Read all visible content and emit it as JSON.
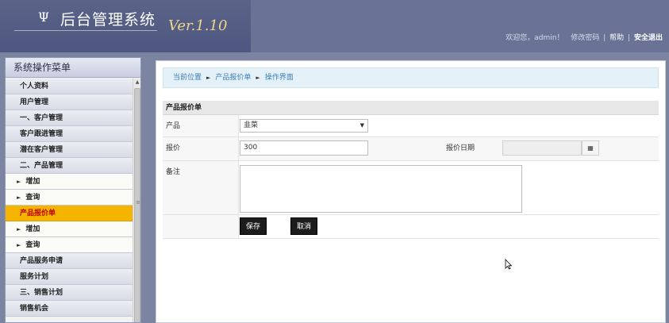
{
  "header": {
    "logo_mark": "Ψ",
    "title": "后台管理系统",
    "version": "Ver.1.10",
    "welcome": "欢迎您，admin！",
    "change_password": "修改密码",
    "help": "帮助",
    "logout": "安全退出",
    "separator": "|"
  },
  "sidebar": {
    "title": "系统操作菜单",
    "items": [
      {
        "label": "个人资料"
      },
      {
        "label": "用户管理"
      },
      {
        "label": "一、客户管理"
      },
      {
        "label": "客户跟进管理"
      },
      {
        "label": "潜在客户管理"
      },
      {
        "label": "二、产品管理"
      },
      {
        "label": "增加"
      },
      {
        "label": "查询"
      },
      {
        "label": "产品报价单"
      },
      {
        "label": "增加"
      },
      {
        "label": "查询"
      },
      {
        "label": "产品服务申请"
      },
      {
        "label": "服务计划"
      },
      {
        "label": "三、销售计划"
      },
      {
        "label": "销售机会"
      }
    ]
  },
  "breadcrumb": {
    "current": "当前位置",
    "level1": "产品报价单",
    "level2": "操作界面"
  },
  "form": {
    "header": "产品报价单",
    "product_label": "产品",
    "product_value": "韭菜",
    "price_label": "报价",
    "price_value": "300",
    "price_date_label": "报价日期",
    "price_date_value": "",
    "note_label": "备注",
    "save": "保存",
    "cancel": "取消"
  },
  "colors": {
    "header_bg": "#6a7396",
    "active_menu": "#f4b400",
    "breadcrumb_text": "#3b7fb8"
  }
}
